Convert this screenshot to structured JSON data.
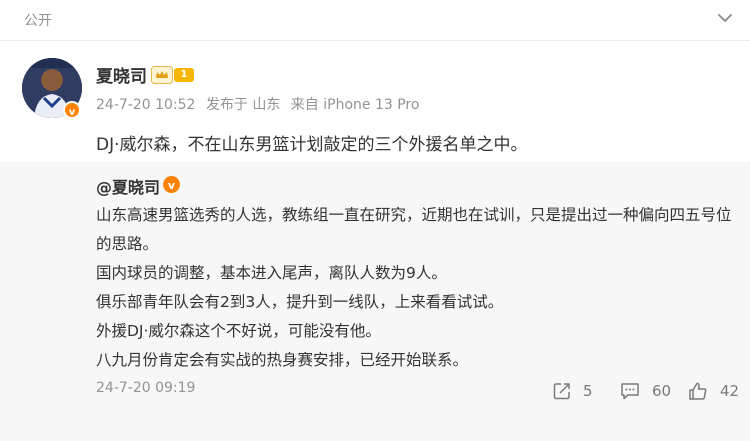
{
  "header": {
    "visibility": "公开"
  },
  "post": {
    "author": "夏晓司",
    "level": "1",
    "meta": {
      "time": "24-7-20 10:52",
      "location": "发布于 山东",
      "source": "来自 iPhone 13 Pro"
    },
    "text": "DJ·威尔森，不在山东男篮计划敲定的三个外援名单之中。"
  },
  "repost": {
    "author": "@夏晓司",
    "lines": [
      "山东高速男篮选秀的人选，教练组一直在研究，近期也在试训，只是提出过一种偏向四五号位的思路。",
      "国内球员的调整，基本进入尾声，离队人数为9人。",
      "俱乐部青年队会有2到3人，提升到一线队，上来看看试试。",
      "外援DJ·威尔森这个不好说，可能没有他。",
      "八九月份肯定会有实战的热身赛安排，已经开始联系。"
    ],
    "time": "24-7-20 09:19",
    "actions": {
      "reposts": "5",
      "comments": "60",
      "likes": "42"
    }
  },
  "colors": {
    "accent": "#ff8200",
    "muted": "#939393",
    "repost_bg": "#f7f7f7"
  }
}
